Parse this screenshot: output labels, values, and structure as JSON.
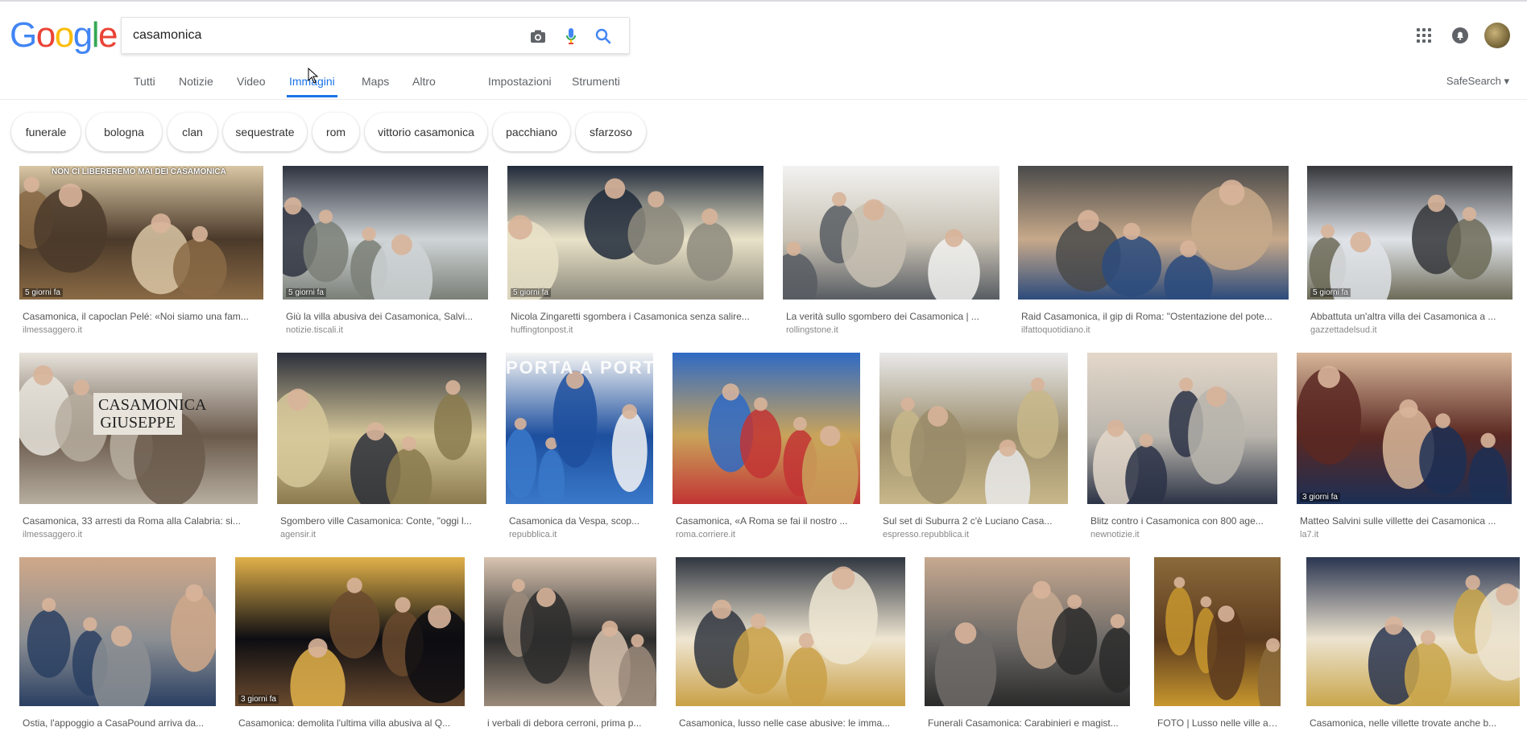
{
  "logo": {
    "letters": [
      "G",
      "o",
      "o",
      "g",
      "l",
      "e"
    ],
    "colors": [
      "#4285F4",
      "#EA4335",
      "#FBBC05",
      "#4285F4",
      "#34A853",
      "#EA4335"
    ]
  },
  "search": {
    "value": "casamonica"
  },
  "icons": {
    "camera": "camera-icon",
    "mic": "microphone-icon",
    "search": "search-icon",
    "apps": "apps-grid-icon",
    "bell": "notifications-icon"
  },
  "nav": [
    {
      "label": "Tutti",
      "active": false
    },
    {
      "label": "Notizie",
      "active": false
    },
    {
      "label": "Video",
      "active": false
    },
    {
      "label": "Immagini",
      "active": true
    },
    {
      "label": "Maps",
      "active": false
    },
    {
      "label": "Altro",
      "active": false
    },
    {
      "label": "Impostazioni",
      "active": false
    },
    {
      "label": "Strumenti",
      "active": false
    }
  ],
  "safesearch": "SafeSearch ▾",
  "chips": [
    "funerale",
    "bologna",
    "clan",
    "sequestrate",
    "rom",
    "vittorio casamonica",
    "pacchiano",
    "sfarzoso"
  ],
  "results": [
    {
      "caption": "Casamonica, il capoclan Pelé: «Noi siamo una fam...",
      "domain": "ilmessaggero.it",
      "badge": "5 giorni fa",
      "overlay": "NON CI LIBEREREMO MAI DEI CASAMONICA",
      "palette": [
        "#4b3a2a",
        "#8a6a45",
        "#d9c6a4"
      ]
    },
    {
      "caption": "Giù la villa abusiva dei Casamonica, Salvi...",
      "domain": "notizie.tiscali.it",
      "badge": "5 giorni fa",
      "palette": [
        "#cfd4d6",
        "#7a7f77",
        "#2e3340"
      ]
    },
    {
      "caption": "Nicola Zingaretti sgombera i Casamonica senza salire...",
      "domain": "huffingtonpost.it",
      "badge": "5 giorni fa",
      "palette": [
        "#e9e2c8",
        "#8d8a7c",
        "#202a3a"
      ]
    },
    {
      "caption": "La verità sullo sgombero dei Casamonica | ...",
      "domain": "rollingstone.it",
      "badge": "",
      "palette": [
        "#c8c1b3",
        "#585d63",
        "#f2f2f0"
      ]
    },
    {
      "caption": "Raid Casamonica, il gip di Roma: \"Ostentazione del pote...",
      "domain": "ilfattoquotidiano.it",
      "badge": "",
      "palette": [
        "#c7a98a",
        "#2c4b7c",
        "#4a4a4a"
      ]
    },
    {
      "caption": "Abbattuta un'altra villa dei Casamonica a ...",
      "domain": "gazzettadelsud.it",
      "badge": "5 giorni fa",
      "palette": [
        "#dfe3e8",
        "#6d6b58",
        "#34363a"
      ]
    },
    {
      "caption": "Casamonica, 33 arresti da Roma alla Calabria: si...",
      "domain": "ilmessaggero.it",
      "badge": "",
      "overlay2": "CASAMONICA GIUSEPPE",
      "palette": [
        "#6a5a4c",
        "#b7aea0",
        "#e8e4dc"
      ]
    },
    {
      "caption": "Sgombero ville Casamonica: Conte, \"oggi l...",
      "domain": "agensir.it",
      "badge": "",
      "palette": [
        "#d7c89a",
        "#8a7a4e",
        "#2b2f3a"
      ]
    },
    {
      "caption": "Casamonica da Vespa, scop...",
      "domain": "repubblica.it",
      "badge": "",
      "overlay3": "PORTA A PORTA",
      "palette": [
        "#1d4f9e",
        "#3a78c9",
        "#f4f4f4"
      ]
    },
    {
      "caption": "Casamonica, «A Roma se fai il nostro ...",
      "domain": "roma.corriere.it",
      "badge": "",
      "palette": [
        "#c9a35a",
        "#c23434",
        "#2f6ac4"
      ]
    },
    {
      "caption": "Sul set di Suburra 2 c'è Luciano Casa...",
      "domain": "espresso.repubblica.it",
      "badge": "",
      "palette": [
        "#9a8c6a",
        "#c8b78a",
        "#e9e9ea"
      ]
    },
    {
      "caption": "Blitz contro i Casamonica con 800 age...",
      "domain": "newnotizie.it",
      "badge": "",
      "palette": [
        "#b9b5ad",
        "#2c3346",
        "#e3d7c9"
      ]
    },
    {
      "caption": "Matteo Salvini sulle villette dei Casamonica ...",
      "domain": "la7.it",
      "badge": "3 giorni fa",
      "palette": [
        "#5a2822",
        "#1c2f55",
        "#d8b79a"
      ]
    },
    {
      "caption": "Ostia, l'appoggio a CasaPound arriva da...",
      "domain": "",
      "badge": "",
      "palette": [
        "#8c8f93",
        "#2a3f62",
        "#cfa889"
      ]
    },
    {
      "caption": "Casamonica: demolita l'ultima villa abusiva al Q...",
      "domain": "",
      "badge": "3 giorni fa",
      "palette": [
        "#0d0d12",
        "#6a4a2e",
        "#e2b14a"
      ]
    },
    {
      "caption": "i verbali di debora cerroni, prima p...",
      "domain": "",
      "badge": "",
      "palette": [
        "#2d2d2d",
        "#9a8a7a",
        "#d9c4b0"
      ]
    },
    {
      "caption": "Casamonica, lusso nelle case abusive: le imma...",
      "domain": "",
      "badge": "",
      "palette": [
        "#efe6d2",
        "#c9a046",
        "#303640"
      ]
    },
    {
      "caption": "Funerali Casamonica: Carabinieri e magist...",
      "domain": "",
      "badge": "",
      "palette": [
        "#6e6b68",
        "#2a2a2a",
        "#c7a990"
      ]
    },
    {
      "caption": "FOTO | Lusso nelle ville ab...",
      "domain": "",
      "badge": "",
      "palette": [
        "#5a3a1e",
        "#c8972e",
        "#8b6a3a"
      ]
    },
    {
      "caption": "Casamonica, nelle villette trovate anche b...",
      "domain": "",
      "badge": "",
      "palette": [
        "#ece3cf",
        "#c9a64b",
        "#2a3550"
      ]
    }
  ]
}
